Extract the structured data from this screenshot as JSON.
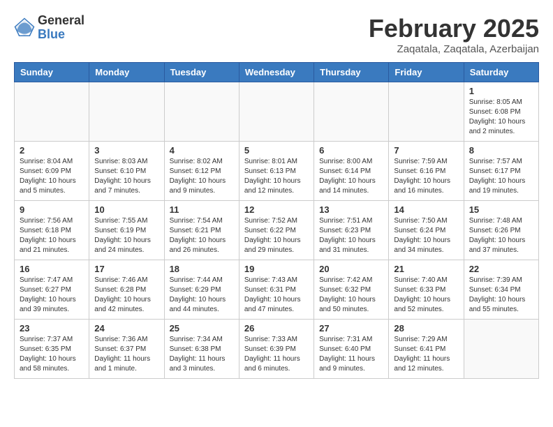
{
  "logo": {
    "general": "General",
    "blue": "Blue"
  },
  "title": "February 2025",
  "location": "Zaqatala, Zaqatala, Azerbaijan",
  "days_of_week": [
    "Sunday",
    "Monday",
    "Tuesday",
    "Wednesday",
    "Thursday",
    "Friday",
    "Saturday"
  ],
  "weeks": [
    [
      {
        "day": "",
        "info": ""
      },
      {
        "day": "",
        "info": ""
      },
      {
        "day": "",
        "info": ""
      },
      {
        "day": "",
        "info": ""
      },
      {
        "day": "",
        "info": ""
      },
      {
        "day": "",
        "info": ""
      },
      {
        "day": "1",
        "info": "Sunrise: 8:05 AM\nSunset: 6:08 PM\nDaylight: 10 hours and 2 minutes."
      }
    ],
    [
      {
        "day": "2",
        "info": "Sunrise: 8:04 AM\nSunset: 6:09 PM\nDaylight: 10 hours and 5 minutes."
      },
      {
        "day": "3",
        "info": "Sunrise: 8:03 AM\nSunset: 6:10 PM\nDaylight: 10 hours and 7 minutes."
      },
      {
        "day": "4",
        "info": "Sunrise: 8:02 AM\nSunset: 6:12 PM\nDaylight: 10 hours and 9 minutes."
      },
      {
        "day": "5",
        "info": "Sunrise: 8:01 AM\nSunset: 6:13 PM\nDaylight: 10 hours and 12 minutes."
      },
      {
        "day": "6",
        "info": "Sunrise: 8:00 AM\nSunset: 6:14 PM\nDaylight: 10 hours and 14 minutes."
      },
      {
        "day": "7",
        "info": "Sunrise: 7:59 AM\nSunset: 6:16 PM\nDaylight: 10 hours and 16 minutes."
      },
      {
        "day": "8",
        "info": "Sunrise: 7:57 AM\nSunset: 6:17 PM\nDaylight: 10 hours and 19 minutes."
      }
    ],
    [
      {
        "day": "9",
        "info": "Sunrise: 7:56 AM\nSunset: 6:18 PM\nDaylight: 10 hours and 21 minutes."
      },
      {
        "day": "10",
        "info": "Sunrise: 7:55 AM\nSunset: 6:19 PM\nDaylight: 10 hours and 24 minutes."
      },
      {
        "day": "11",
        "info": "Sunrise: 7:54 AM\nSunset: 6:21 PM\nDaylight: 10 hours and 26 minutes."
      },
      {
        "day": "12",
        "info": "Sunrise: 7:52 AM\nSunset: 6:22 PM\nDaylight: 10 hours and 29 minutes."
      },
      {
        "day": "13",
        "info": "Sunrise: 7:51 AM\nSunset: 6:23 PM\nDaylight: 10 hours and 31 minutes."
      },
      {
        "day": "14",
        "info": "Sunrise: 7:50 AM\nSunset: 6:24 PM\nDaylight: 10 hours and 34 minutes."
      },
      {
        "day": "15",
        "info": "Sunrise: 7:48 AM\nSunset: 6:26 PM\nDaylight: 10 hours and 37 minutes."
      }
    ],
    [
      {
        "day": "16",
        "info": "Sunrise: 7:47 AM\nSunset: 6:27 PM\nDaylight: 10 hours and 39 minutes."
      },
      {
        "day": "17",
        "info": "Sunrise: 7:46 AM\nSunset: 6:28 PM\nDaylight: 10 hours and 42 minutes."
      },
      {
        "day": "18",
        "info": "Sunrise: 7:44 AM\nSunset: 6:29 PM\nDaylight: 10 hours and 44 minutes."
      },
      {
        "day": "19",
        "info": "Sunrise: 7:43 AM\nSunset: 6:31 PM\nDaylight: 10 hours and 47 minutes."
      },
      {
        "day": "20",
        "info": "Sunrise: 7:42 AM\nSunset: 6:32 PM\nDaylight: 10 hours and 50 minutes."
      },
      {
        "day": "21",
        "info": "Sunrise: 7:40 AM\nSunset: 6:33 PM\nDaylight: 10 hours and 52 minutes."
      },
      {
        "day": "22",
        "info": "Sunrise: 7:39 AM\nSunset: 6:34 PM\nDaylight: 10 hours and 55 minutes."
      }
    ],
    [
      {
        "day": "23",
        "info": "Sunrise: 7:37 AM\nSunset: 6:35 PM\nDaylight: 10 hours and 58 minutes."
      },
      {
        "day": "24",
        "info": "Sunrise: 7:36 AM\nSunset: 6:37 PM\nDaylight: 11 hours and 1 minute."
      },
      {
        "day": "25",
        "info": "Sunrise: 7:34 AM\nSunset: 6:38 PM\nDaylight: 11 hours and 3 minutes."
      },
      {
        "day": "26",
        "info": "Sunrise: 7:33 AM\nSunset: 6:39 PM\nDaylight: 11 hours and 6 minutes."
      },
      {
        "day": "27",
        "info": "Sunrise: 7:31 AM\nSunset: 6:40 PM\nDaylight: 11 hours and 9 minutes."
      },
      {
        "day": "28",
        "info": "Sunrise: 7:29 AM\nSunset: 6:41 PM\nDaylight: 11 hours and 12 minutes."
      },
      {
        "day": "",
        "info": ""
      }
    ]
  ]
}
